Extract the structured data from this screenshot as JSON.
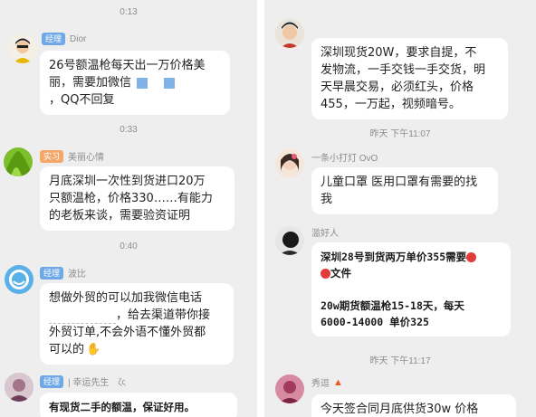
{
  "left": {
    "header_cut": "",
    "timestamps": [
      "0:13",
      "0:33",
      "0:40"
    ],
    "messages": [
      {
        "badge": "经理",
        "name": "Dior",
        "lines": [
          "26号额温枪每天出一万价格美",
          "丽，需要加微信",
          "，QQ不回复"
        ]
      },
      {
        "badge": "实习",
        "name": "美丽心情",
        "lines": [
          "月底深圳一次性到货进口20万",
          "只额温枪，价格330……有能力",
          "的老板来谈，需要验资证明"
        ]
      },
      {
        "badge": "经理",
        "name": "波比",
        "lines": [
          "想做外贸的可以加我微信电话",
          "，给去渠道带你接",
          "外贸订单,不会外语不懂外贸都",
          "可以的"
        ]
      },
      {
        "badge": "经理",
        "name": "| 幸运先生",
        "name_suffix": "ζς",
        "lines": [
          "有现货二手的额温，保证好用。"
        ]
      }
    ]
  },
  "right": {
    "timestamps": [
      "昨天 下午11:07",
      "昨天 下午11:17"
    ],
    "messages": [
      {
        "lines": [
          "深圳现货20W，要求自提，不",
          "发物流，一手交钱一手交货，明",
          "天早晨交易，必须红头，价格",
          "455，一万起，视频暗号。"
        ]
      },
      {
        "name": "一条小打灯 OvO",
        "lines": [
          "儿童口罩 医用口罩有需要的找",
          "我"
        ]
      },
      {
        "name": "滥好人",
        "lines": [
          "深圳28号到货两万单价355需要",
          "文件",
          "",
          "20w期货额温枪15-18天，每天",
          "6000-14000 单价325"
        ]
      },
      {
        "name": "秀逗",
        "lines": [
          "今天签合同月底供货30w 价格"
        ]
      }
    ]
  },
  "colors": {
    "bg": "#eeeeee",
    "bubble": "#ffffff",
    "badge_blue": "#6fa8e6",
    "badge_orange": "#f4a76b",
    "meta_text": "#8c8c8c"
  },
  "icons": [
    "avatar",
    "blue-square-emoji",
    "wave-hand-emoji",
    "red-dot-emoji",
    "fire-emoji"
  ]
}
